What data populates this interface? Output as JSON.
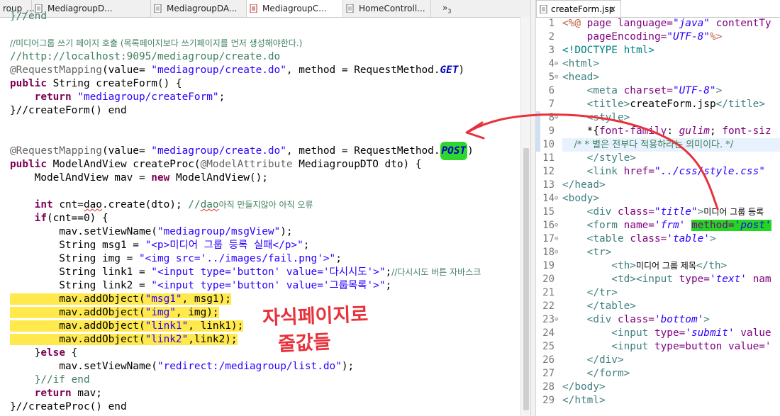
{
  "left_tabs": [
    {
      "label": "roup_..."
    },
    {
      "label": "MediagroupD..."
    },
    {
      "label": "MediagroupDA..."
    },
    {
      "label": "MediagroupC..."
    },
    {
      "label": "HomeControll..."
    }
  ],
  "tab_overflow": {
    "label": "»",
    "count": "3"
  },
  "code": {
    "l0": "}//end",
    "l1": "//미디어그룹 쓰기 페이지 호출 (목록페이지보다 쓰기페이지를 먼저 생성해야한다.)",
    "l2": "//http://localhost:9095/mediagroup/create.do",
    "l3a": "@RequestMapping",
    "l3b": "(value= ",
    "l3c": "\"mediagroup/create.do\"",
    "l3d": ", method = RequestMethod.",
    "l3e": "GET",
    "l3f": ")",
    "l4a": "public",
    "l4b": " String createForm() {",
    "l5a": "    return",
    "l5b": " ",
    "l5c": "\"mediagroup/createForm\"",
    "l5d": ";",
    "l6": "}//createForm() end",
    "l7a": "@RequestMapping",
    "l7b": "(value= ",
    "l7c": "\"mediagroup/create.do\"",
    "l7d": ", method = RequestMethod.",
    "l7e": "POST",
    "l7f": ")",
    "l8a": "public",
    "l8b": " ModelAndView createProc(",
    "l8c": "@ModelAttribute",
    "l8d": " MediagroupDTO dto) {",
    "l9a": "    ModelAndView mav = ",
    "l9b": "new",
    "l9c": " ModelAndView();",
    "l10a": "    int",
    "l10b": " cnt=",
    "l10c": "dao",
    "l10d": ".create(dto); ",
    "l10e": "//",
    "l10f": "dao",
    "l10g": "아직 만들지않아 아직 오류",
    "l11a": "    if",
    "l11b": "(cnt==0) {",
    "l12a": "        mav.setViewName(",
    "l12b": "\"mediagroup/msgView\"",
    "l12c": ");",
    "l13a": "        String msg1 = ",
    "l13b": "\"<p>미디어 그룹 등록 실패</p>\"",
    "l13c": ";",
    "l14a": "        String img = ",
    "l14b": "\"<img src='../images/fail.png'>\"",
    "l14c": ";",
    "l15a": "        String link1 = ",
    "l15b": "\"<input type='button' value='다시시도'>\"",
    "l15c": ";",
    "l15d": "//다시시도 버튼 자바스크",
    "l16a": "        String link2 = ",
    "l16b": "\"<input type='button' value='그룹목록'>\"",
    "l16c": ";",
    "l17a": "        mav.addObject(",
    "l17b": "\"msg1\"",
    "l17c": ", msg1);",
    "l18a": "        mav.addObject(",
    "l18b": "\"img\"",
    "l18c": ", img);",
    "l19a": "        mav.addObject(",
    "l19b": "\"link1\"",
    "l19c": ", link1);",
    "l20a": "        mav.addObject(",
    "l20b": "\"link2\"",
    "l20c": ",link2);",
    "l21a": "    }",
    "l21b": "else",
    "l21c": " {",
    "l22a": "        mav.setViewName(",
    "l22b": "\"redirect:/mediagroup/list.do\"",
    "l22c": ");",
    "l23": "    }//if end",
    "l24a": "    return",
    "l24b": " mav;",
    "l25": "}//createProc() end"
  },
  "annotation": {
    "line1": "자식페이지로",
    "line2": "줄값들"
  },
  "right_tab": {
    "label": "createForm.jsp",
    "close": "✕"
  },
  "jsp": {
    "n1": "1",
    "n2": "2",
    "n3": "3",
    "n4": "4",
    "n5": "5",
    "n6": "6",
    "n7": "7",
    "n8": "8",
    "n9": "9",
    "n10": "10",
    "n11": "11",
    "n12": "12",
    "n13": "13",
    "n14": "14",
    "n15": "15",
    "n16": "16",
    "n17": "17",
    "n18": "18",
    "n19": "19",
    "n20": "20",
    "n21": "21",
    "n22": "22",
    "n23": "23",
    "n24": "24",
    "n25": "25",
    "n26": "26",
    "n27": "27",
    "n28": "28",
    "n29": "29",
    "r1a": "<%@",
    "r1b": " page ",
    "r1c": "language=",
    "r1d": "\"java\"",
    "r1e": " contentTy",
    "r2a": "    pageEncoding=",
    "r2b": "\"UTF-8\"",
    "r2c": "%>",
    "r3": "<!DOCTYPE html>",
    "r4": "<html>",
    "r5": "<head>",
    "r6a": "    <meta ",
    "r6b": "charset=",
    "r6c": "\"UTF-8\"",
    "r6d": ">",
    "r7a": "    <title>",
    "r7b": "createForm.jsp",
    "r7c": "</title>",
    "r8": "    <style>",
    "r9a": "    *",
    "r9b": "{",
    "r9c": "font-family",
    "r9d": ": ",
    "r9e": "gulim",
    "r9f": "; ",
    "r9g": "font-siz",
    "r10": "    /* * 별은 전부다 적용하라는 의미이다. */",
    "r11": "    </style>",
    "r12a": "    <link ",
    "r12b": "href=",
    "r12c": "\"../css/style.css\"",
    "r13": "</head>",
    "r14": "<body>",
    "r15a": "    <div ",
    "r15b": "class=",
    "r15c": "\"title\"",
    "r15d": ">",
    "r15e": "미디어 그룹 등록",
    "r16a": "    <form ",
    "r16b": "name=",
    "r16c": "'frm'",
    "r16d": " ",
    "r16e": "method=",
    "r16f": "'post'",
    "r17a": "    <table ",
    "r17b": "class=",
    "r17c": "'table'",
    "r17d": ">",
    "r18": "    <tr>",
    "r19a": "        <th>",
    "r19b": "미디어 그룹 제목",
    "r19c": "</th>",
    "r20a": "        <td><input ",
    "r20b": "type=",
    "r20c": "'text'",
    "r20d": " nam",
    "r21": "    </tr>",
    "r22": "    </table>",
    "r23a": "    <div ",
    "r23b": "class=",
    "r23c": "'bottom'",
    "r23d": ">",
    "r24a": "        <input ",
    "r24b": "type=",
    "r24c": "'submit'",
    "r24d": " value",
    "r25a": "        <input ",
    "r25b": "type=",
    "r25c": "button",
    "r25d": " value='",
    "r26": "    </div>",
    "r27": "    </form>",
    "r28": "</body>",
    "r29": "</html>"
  },
  "colors": {
    "annotation": "#e8313a",
    "highlight_yellow": "#ffe94d",
    "highlight_green": "#22d622"
  }
}
